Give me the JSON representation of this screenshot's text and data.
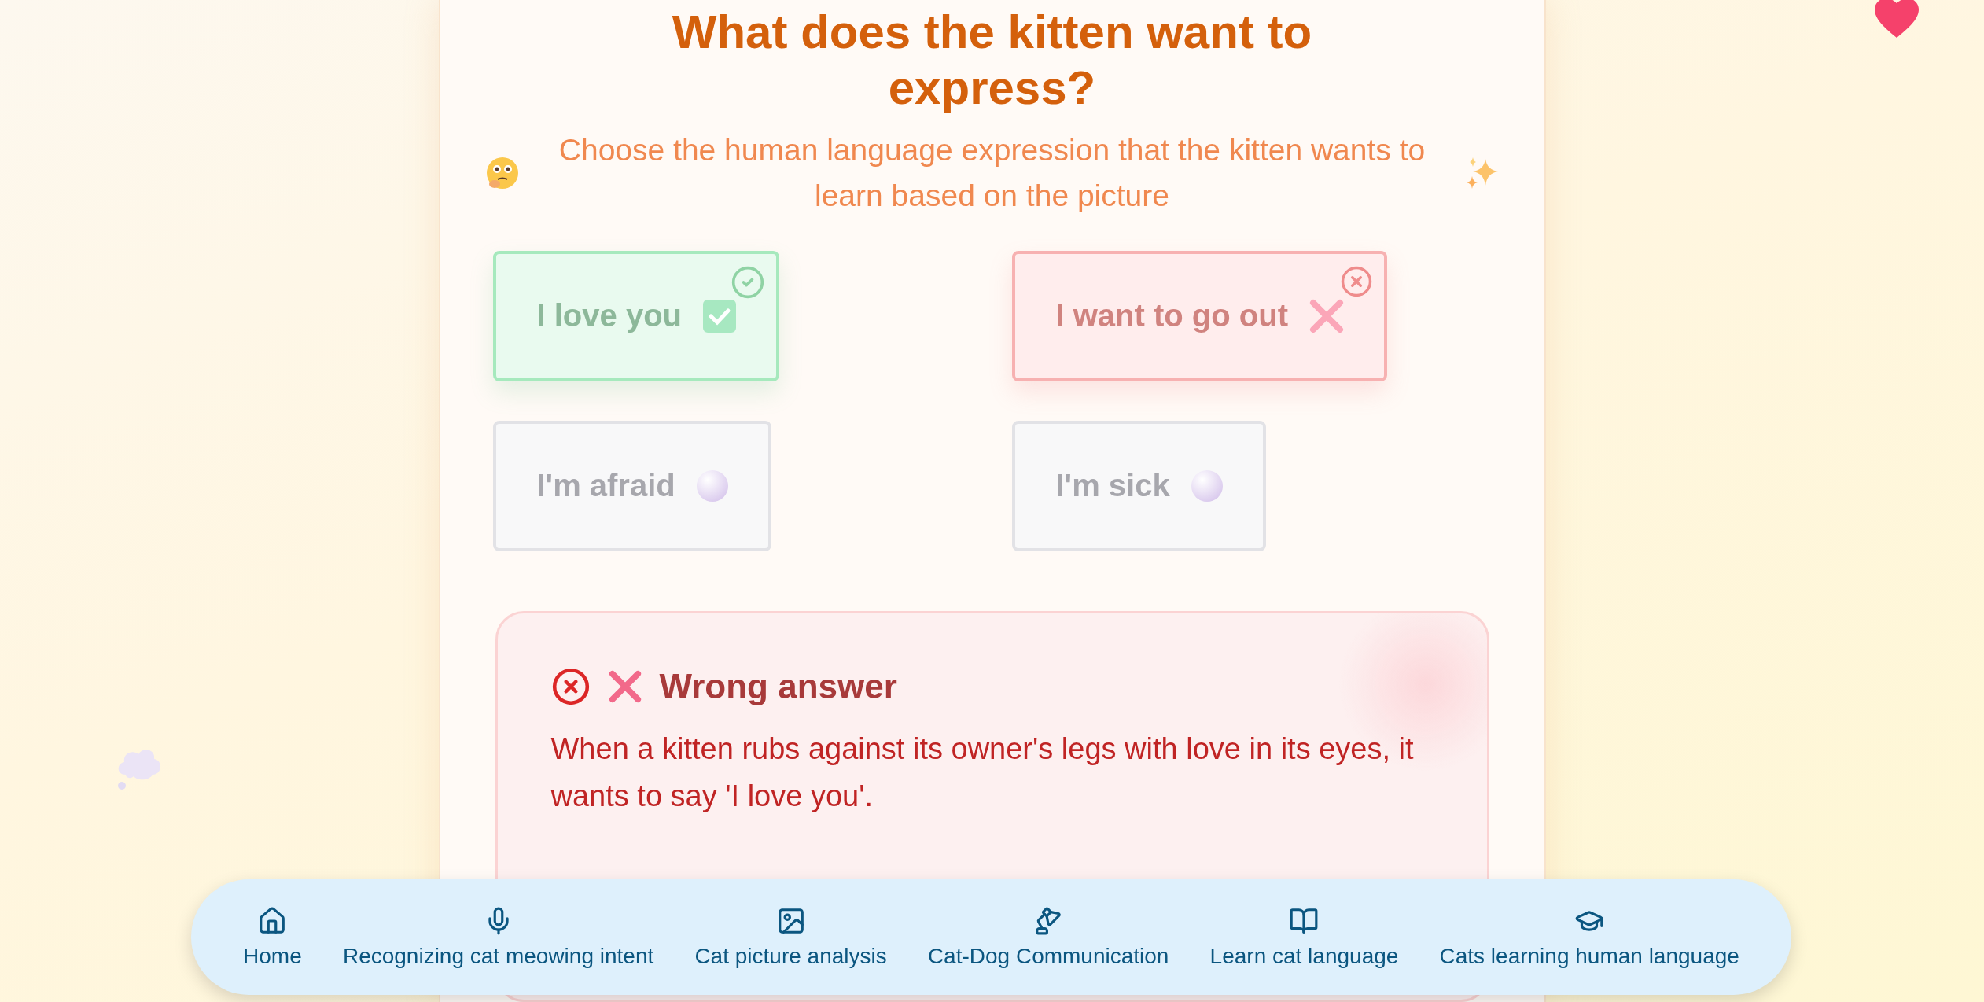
{
  "question": {
    "title": "What does the kitten want to express?",
    "subtitle": "Choose the human language expression that the kitten wants to learn based on the picture"
  },
  "options": [
    {
      "label": "I love you",
      "kind": "correct"
    },
    {
      "label": "I want to go out",
      "kind": "wrong"
    },
    {
      "label": "I'm afraid",
      "kind": "neutral"
    },
    {
      "label": "I'm sick",
      "kind": "neutral"
    }
  ],
  "feedback": {
    "kind": "wrong",
    "title": "Wrong answer",
    "message": "When a kitten rubs against its owner's legs with love in its eyes, it wants to say 'I love you'."
  },
  "nav": [
    {
      "label": "Home"
    },
    {
      "label": "Recognizing cat meowing intent"
    },
    {
      "label": "Cat picture analysis"
    },
    {
      "label": "Cat-Dog Communication"
    },
    {
      "label": "Learn cat language"
    },
    {
      "label": "Cats learning human language"
    }
  ]
}
